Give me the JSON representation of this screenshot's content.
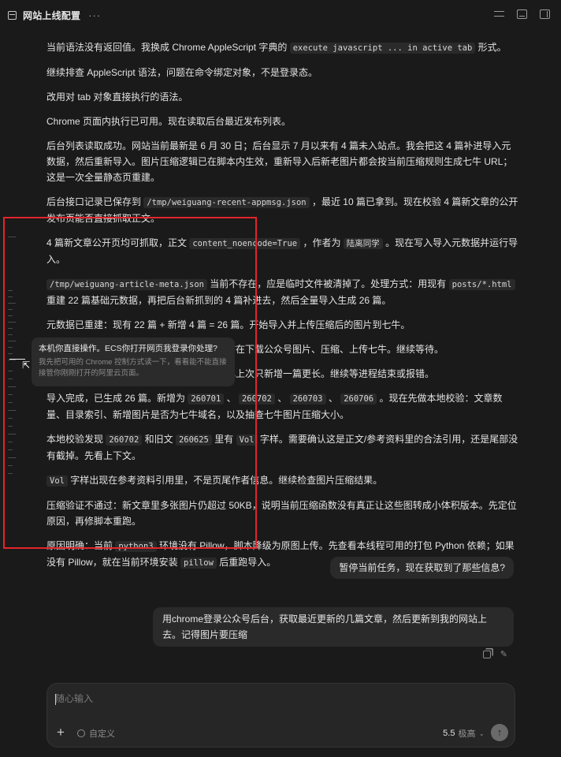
{
  "window": {
    "title": "网站上线配置",
    "more": "···"
  },
  "messages": [
    [
      {
        "t": "当前语法没有返回值。我换成 Chrome AppleScript 字典的 "
      },
      {
        "c": "execute javascript ... in active tab"
      },
      {
        "t": " 形式。"
      }
    ],
    [
      {
        "t": "继续排查 AppleScript 语法，问题在命令绑定对象，不是登录态。"
      }
    ],
    [
      {
        "t": "改用对 tab 对象直接执行的语法。"
      }
    ],
    [
      {
        "t": "Chrome 页面内执行已可用。现在读取后台最近发布列表。"
      }
    ],
    [
      {
        "t": "后台列表读取成功。网站当前最新是 6 月 30 日；后台显示 7 月以来有 4 篇未入站点。我会把这 4 篇补进导入元数据，然后重新导入。图片压缩逻辑已在脚本内生效，重新导入后新老图片都会按当前压缩规则生成七牛 URL；这是一次全量静态页重建。"
      }
    ],
    [
      {
        "t": "后台接口记录已保存到 "
      },
      {
        "c": "/tmp/weiguang-recent-appmsg.json"
      },
      {
        "t": " ，最近 10 篇已拿到。现在校验 4 篇新文章的公开发布页能否直接抓取正文。"
      }
    ],
    [
      {
        "t": "4 篇新文章公开页均可抓取，正文 "
      },
      {
        "c": "content_noencode=True"
      },
      {
        "t": " ，作者为 "
      },
      {
        "c": "陆离同学"
      },
      {
        "t": " 。现在写入导入元数据并运行导入。"
      }
    ],
    [
      {
        "c": "/tmp/weiguang-article-meta.json"
      },
      {
        "t": " 当前不存在，应是临时文件被清掉了。处理方式：用现有 "
      },
      {
        "c": "posts/*.html"
      },
      {
        "t": " 重建 22 篇基础元数据，再把后台新抓到的 4 篇补进去，然后全量导入生成 26 篇。"
      }
    ],
    [
      {
        "t": "元数据已重建：现有 22 篇 + 新增 4 篇 = 26 篇。开始导入并上传压缩后的图片到七牛。"
      }
    ],
    [
      {
        "t": "导入仍在运行，当前没有错误输出。主要耗时在下载公众号图片、压缩、上传七牛。继续等待。"
      }
    ],
    [
      {
        "t": "导入还在运行，新增文章图片较多，耗时会比上次只新增一篇更长。继续等进程结束或报错。"
      }
    ],
    [
      {
        "t": "导入完成，已生成 26 篇。新增为 "
      },
      {
        "c": "260701"
      },
      {
        "t": " 、 "
      },
      {
        "c": "260702"
      },
      {
        "t": " 、 "
      },
      {
        "c": "260703"
      },
      {
        "t": " 、 "
      },
      {
        "c": "260706"
      },
      {
        "t": " 。现在先做本地校验：文章数量、目录索引、新增图片是否为七牛域名，以及抽查七牛图片压缩大小。"
      }
    ],
    [
      {
        "t": "本地校验发现 "
      },
      {
        "c": "260702"
      },
      {
        "t": " 和旧文 "
      },
      {
        "c": "260625"
      },
      {
        "t": " 里有 "
      },
      {
        "c": "Vol"
      },
      {
        "t": " 字样。需要确认这是正文/参考资料里的合法引用，还是尾部没有截掉。先看上下文。"
      }
    ],
    [
      {
        "c": "Vol"
      },
      {
        "t": " 字样出现在参考资料引用里，不是页尾作者信息。继续检查图片压缩结果。"
      }
    ],
    [
      {
        "t": "压缩验证不通过：新文章里多张图片仍超过 50KB，说明当前压缩函数没有真正让这些图转成小体积版本。先定位原因，再修脚本重跑。"
      }
    ],
    [
      {
        "t": "原因明确：当前 "
      },
      {
        "c": "python3"
      },
      {
        "t": " 环境没有 Pillow，脚本降级为原图上传。先查看本线程可用的打包 Python 依赖；如果没有 Pillow，就在当前环境安装 "
      },
      {
        "c": "pillow"
      },
      {
        "t": " 后重跑导入。"
      }
    ]
  ],
  "tooltip": {
    "title": "本机你直接操作。ECS你打开网页我登录你处理?",
    "subtitle": "我先把可用的 Chrome 控制方式读一下，看看能不能直接接管你刚刚打开的阿里云页面。"
  },
  "user_messages": {
    "pause": "暂停当前任务，现在获取到了那些信息?",
    "request": "用chrome登录公众号后台，获取最近更新的几篇文章，然后更新到我的网站上去。记得图片要压缩"
  },
  "composer": {
    "placeholder": "随心输入",
    "plus": "+",
    "custom_label": "自定义",
    "model_version": "5.5",
    "model_level": "极高",
    "send_glyph": "↑"
  },
  "colors": {
    "background": "#1a1a1a",
    "highlight_box": "#e3242b",
    "bubble": "#2a2a2a"
  }
}
